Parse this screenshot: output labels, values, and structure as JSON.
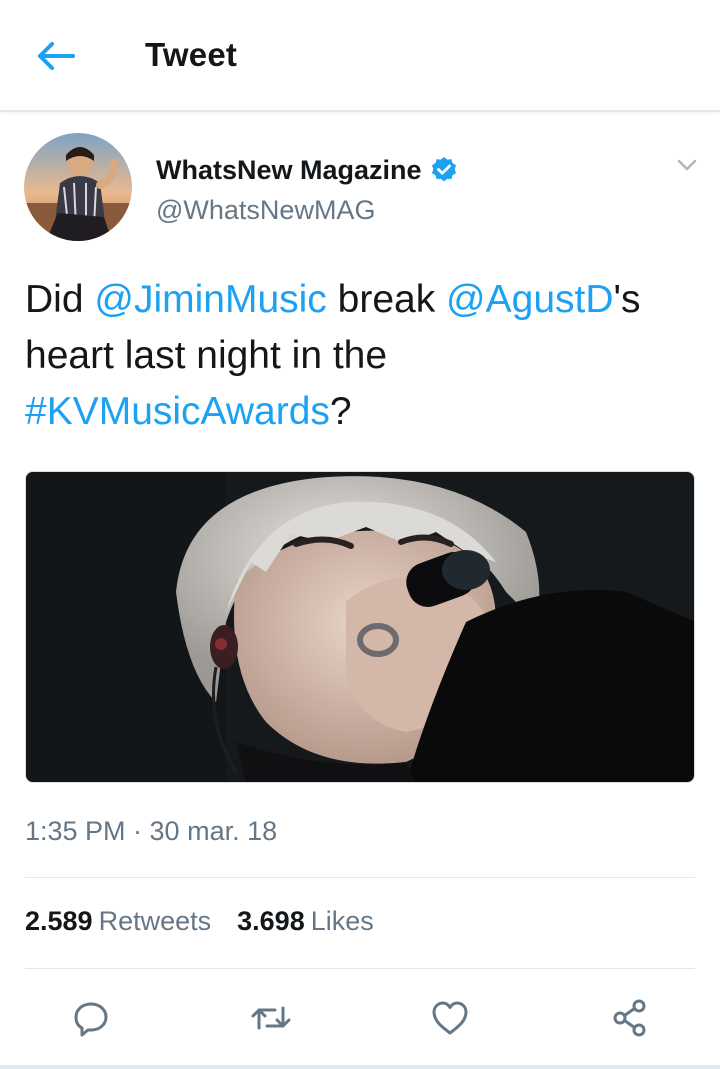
{
  "colors": {
    "accent": "#1da1f2",
    "text": "#14171a",
    "secondary": "#657786",
    "divider": "#e1e8ed"
  },
  "header": {
    "title": "Tweet",
    "back_icon": "arrow-left-icon"
  },
  "tweet": {
    "author": {
      "name": "WhatsNew Magazine",
      "handle": "@WhatsNewMAG",
      "verified": true,
      "verified_icon": "verified-badge-icon"
    },
    "text": {
      "w1": "Did ",
      "m1": "@JiminMusic",
      "w2": " break ",
      "m2": "@AgustD",
      "w3": "'s heart last night in the ",
      "h1": "#KVMusicAwards",
      "w4": "?"
    },
    "timestamp": "1:35 PM · 30 mar. 18",
    "stats": {
      "retweets_count": "2.589",
      "retweets_label": "Retweets",
      "likes_count": "3.698",
      "likes_label": "Likes"
    },
    "actions": [
      "reply-icon",
      "retweet-icon",
      "like-icon",
      "share-icon"
    ]
  }
}
